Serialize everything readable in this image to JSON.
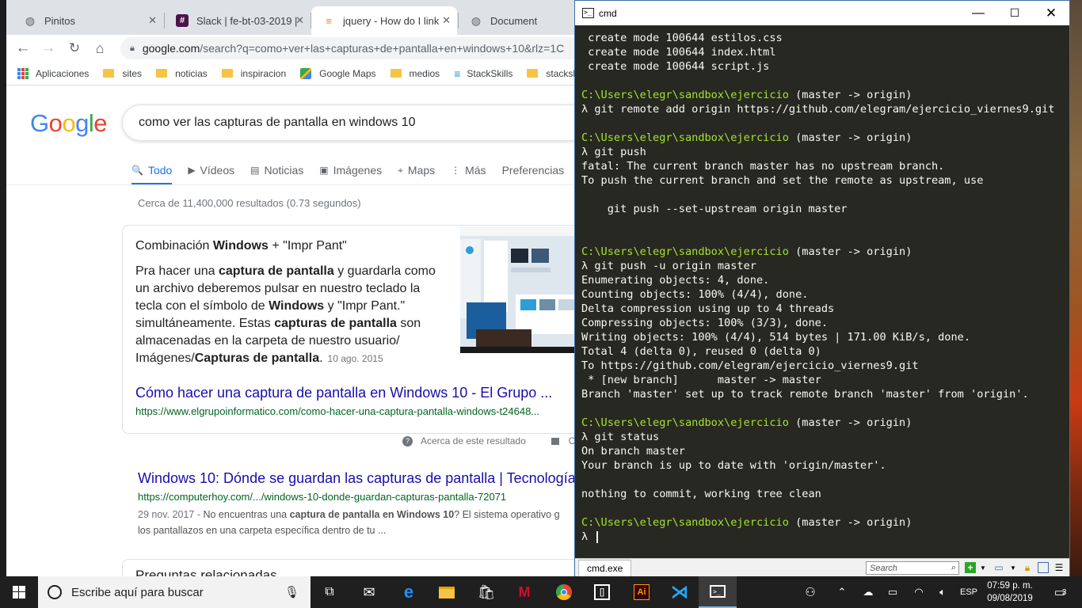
{
  "chrome": {
    "tabs": [
      {
        "title": "Pinitos",
        "icon": "globe-icon"
      },
      {
        "title": "Slack | fe-bt-03-2019 |",
        "icon": "slack-icon"
      },
      {
        "title": "jquery - How do I link",
        "icon": "stackoverflow-icon"
      },
      {
        "title": "Document",
        "icon": "globe-icon"
      }
    ],
    "tab_close": "✕",
    "omnibox": {
      "host": "google.com",
      "path": "/search?q=como+ver+las+capturas+de+pantalla+en+windows+10&rlz=1C"
    },
    "bookmarks": [
      "Aplicaciones",
      "sites",
      "noticias",
      "inspiracion",
      "Google Maps",
      "medios",
      "StackSkills",
      "stackskills"
    ]
  },
  "google": {
    "logo": [
      "G",
      "o",
      "o",
      "g",
      "l",
      "e"
    ],
    "query": "como ver las capturas de pantalla en windows 10",
    "tabs": [
      {
        "label": "Todo",
        "icon": "🔍"
      },
      {
        "label": "Vídeos",
        "icon": "▶"
      },
      {
        "label": "Noticias",
        "icon": "▤"
      },
      {
        "label": "Imágenes",
        "icon": "▣"
      },
      {
        "label": "Maps",
        "icon": "⌖"
      },
      {
        "label": "Más",
        "icon": "⋮"
      },
      {
        "label": "Preferencias",
        "icon": ""
      }
    ],
    "stats": "Cerca de 11,400,000 resultados (0.73 segundos)",
    "snippet": {
      "title_a": "Combinación ",
      "title_b": "Windows",
      "title_c": " + \"Impr Pant\"",
      "t1": "Pra hacer una ",
      "b1": "captura de pantalla",
      "t2": " y guardarla como un archivo deberemos pulsar en nuestro teclado la tecla con el símbolo de ",
      "b2": "Windows",
      "t3": " y \"Impr Pant.\" simultáneamente. Estas ",
      "b3": "capturas de pantalla",
      "t4": " son almacenadas en la carpeta de nuestro usuario/ Imágenes/",
      "b4": "Capturas de pantalla",
      "t5": ".",
      "date": "10 ago. 2015",
      "link": "Cómo hacer una captura de pantalla en Windows 10 - El Grupo ...",
      "url": "https://www.elgrupoinformatico.com/como-hacer-una-captura-pantalla-windows-t24648..."
    },
    "about": "Acerca de este resultado",
    "feedback": "Co",
    "result2": {
      "title": "Windows 10: Dónde se guardan las capturas de pantalla | Tecnología",
      "url": "https://computerhoy.com/.../windows-10-donde-guardan-capturas-pantalla-72071",
      "date": "29 nov. 2017 - ",
      "d1": "No encuentras una ",
      "b1": "captura de pantalla en Windows 10",
      "d2": "? El sistema operativo g",
      "d3": "los pantallazos en una carpeta específica dentro de tu ..."
    },
    "related": "Preguntas relacionadas"
  },
  "cmd": {
    "title": "cmd",
    "lines": [
      {
        "t": " create mode 100644 estilos.css"
      },
      {
        "t": " create mode 100644 index.html"
      },
      {
        "t": " create mode 100644 script.js"
      },
      {
        "t": ""
      },
      {
        "p": "C:\\Users\\elegr\\sandbox\\ejercicio",
        "t": " (master -> origin)"
      },
      {
        "t": "λ git remote add origin https://github.com/elegram/ejercicio_viernes9.git"
      },
      {
        "t": ""
      },
      {
        "p": "C:\\Users\\elegr\\sandbox\\ejercicio",
        "t": " (master -> origin)"
      },
      {
        "t": "λ git push"
      },
      {
        "t": "fatal: The current branch master has no upstream branch."
      },
      {
        "t": "To push the current branch and set the remote as upstream, use"
      },
      {
        "t": ""
      },
      {
        "t": "    git push --set-upstream origin master"
      },
      {
        "t": ""
      },
      {
        "t": ""
      },
      {
        "p": "C:\\Users\\elegr\\sandbox\\ejercicio",
        "t": " (master -> origin)"
      },
      {
        "t": "λ git push -u origin master"
      },
      {
        "t": "Enumerating objects: 4, done."
      },
      {
        "t": "Counting objects: 100% (4/4), done."
      },
      {
        "t": "Delta compression using up to 4 threads"
      },
      {
        "t": "Compressing objects: 100% (3/3), done."
      },
      {
        "t": "Writing objects: 100% (4/4), 514 bytes | 171.00 KiB/s, done."
      },
      {
        "t": "Total 4 (delta 0), reused 0 (delta 0)"
      },
      {
        "t": "To https://github.com/elegram/ejercicio_viernes9.git"
      },
      {
        "t": " * [new branch]      master -> master"
      },
      {
        "t": "Branch 'master' set up to track remote branch 'master' from 'origin'."
      },
      {
        "t": ""
      },
      {
        "p": "C:\\Users\\elegr\\sandbox\\ejercicio",
        "t": " (master -> origin)"
      },
      {
        "t": "λ git status"
      },
      {
        "t": "On branch master"
      },
      {
        "t": "Your branch is up to date with 'origin/master'."
      },
      {
        "t": ""
      },
      {
        "t": "nothing to commit, working tree clean"
      },
      {
        "t": ""
      },
      {
        "p": "C:\\Users\\elegr\\sandbox\\ejercicio",
        "t": " (master -> origin)"
      },
      {
        "t": "λ ",
        "cursor": true
      }
    ],
    "status_tab": "cmd.exe",
    "search_placeholder": "Search"
  },
  "taskbar": {
    "search_placeholder": "Escribe aquí para buscar",
    "lang": "ESP",
    "time": "07:59 p. m.",
    "date": "09/08/2019",
    "notifications": "3"
  },
  "colors": {
    "prompt_path": "#a6e22e",
    "cmd_bg": "#272822",
    "link": "#1a0dab",
    "url": "#006621",
    "accent": "#1a73e8"
  }
}
